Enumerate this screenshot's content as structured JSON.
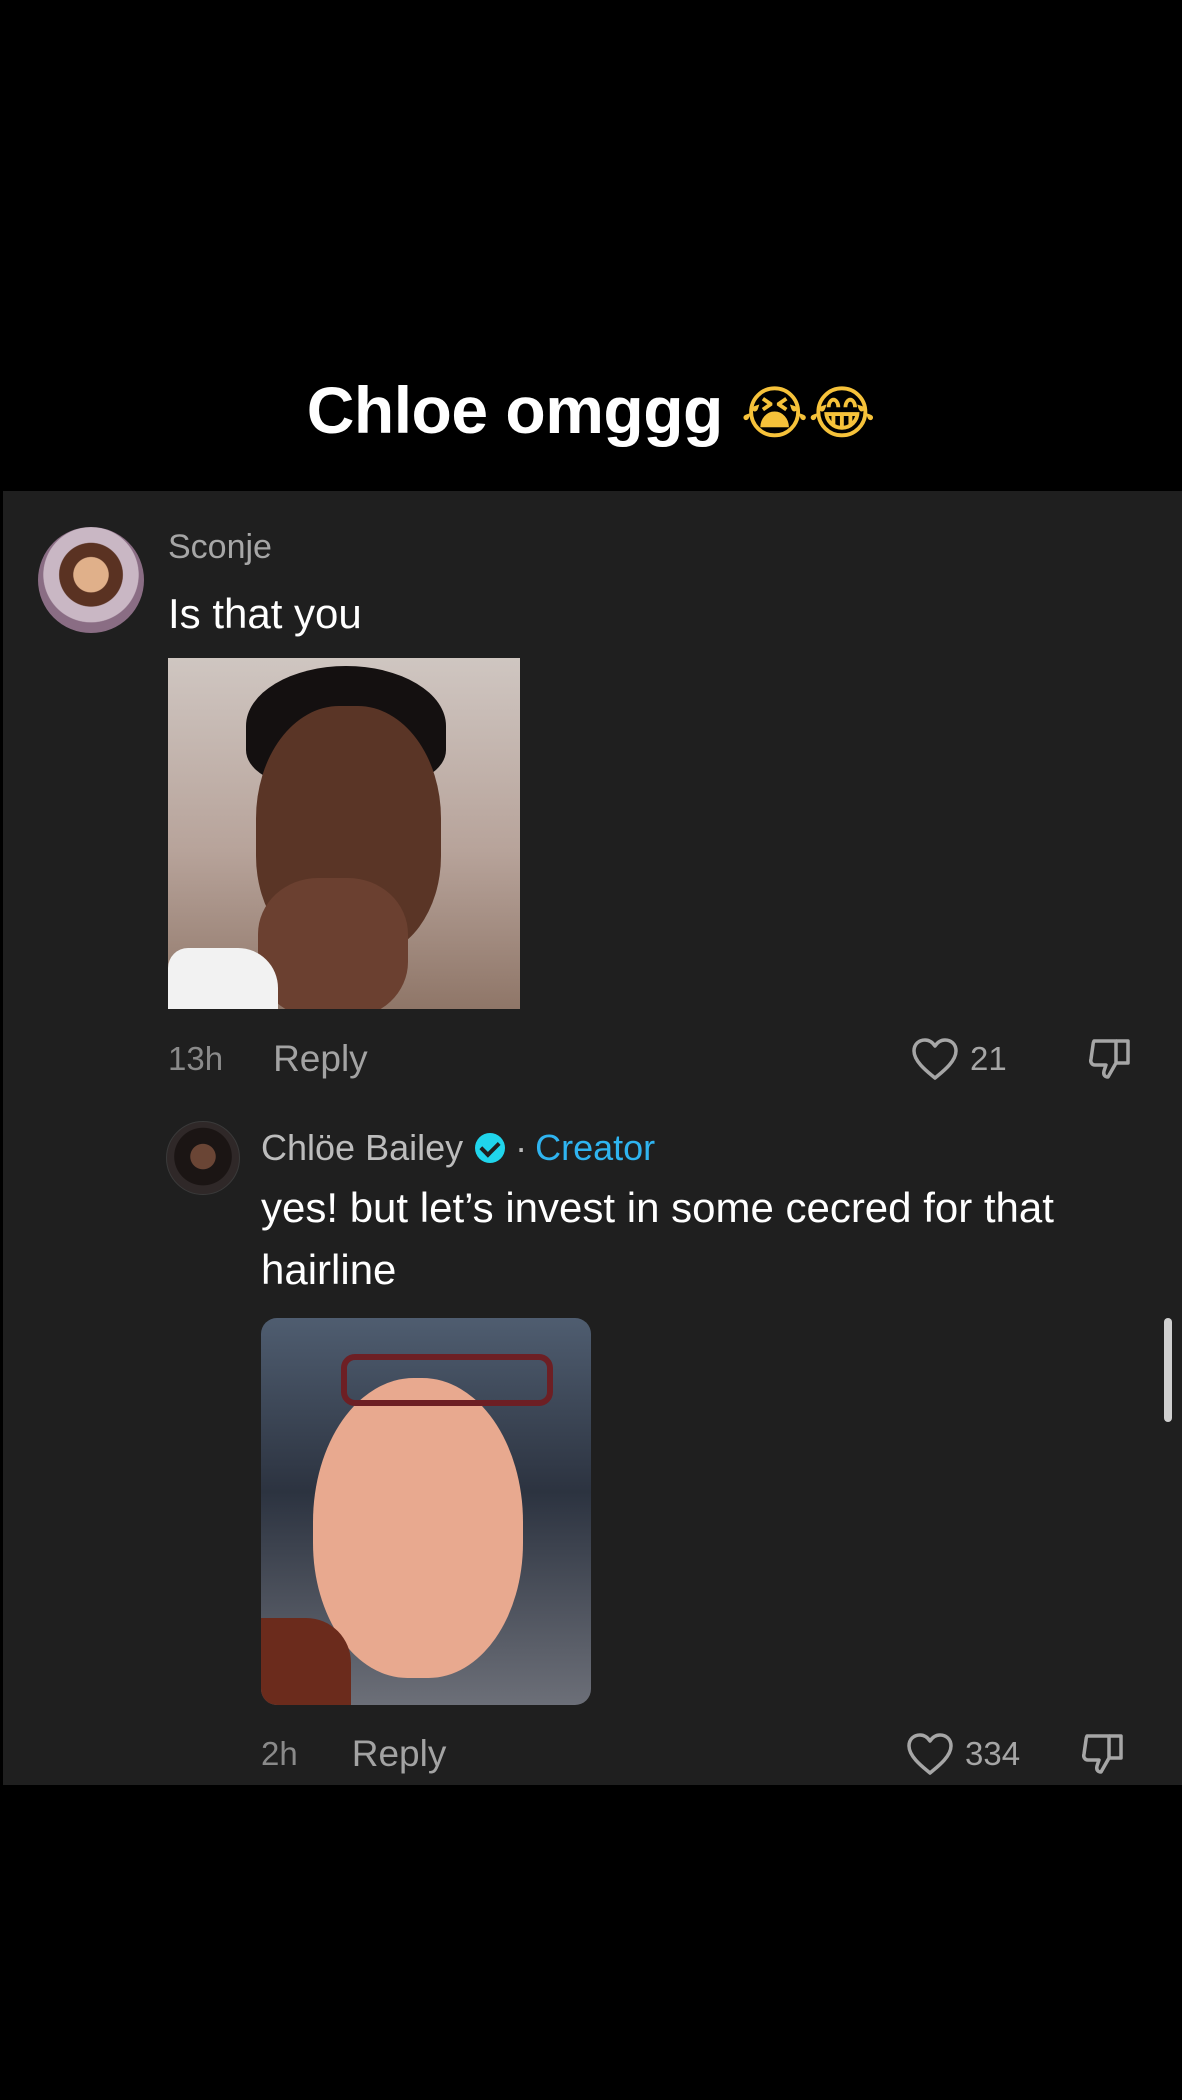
{
  "caption": {
    "text": "Chloe omggg",
    "emojis": "😭😂"
  },
  "comments": [
    {
      "username": "Sconje",
      "text": "Is that you",
      "time": "13h",
      "reply_label": "Reply",
      "likes": "21"
    }
  ],
  "reply": {
    "username": "Chlöe Bailey",
    "separator": "·",
    "badge": "Creator",
    "text": "yes! but let’s invest in some cecred for that hairline",
    "time": "2h",
    "reply_label": "Reply",
    "likes": "334"
  },
  "colors": {
    "background": "#000000",
    "panel": "#1f1f1f",
    "creator_accent": "#2fb4f0",
    "verified_badge": "#20d5ec"
  }
}
